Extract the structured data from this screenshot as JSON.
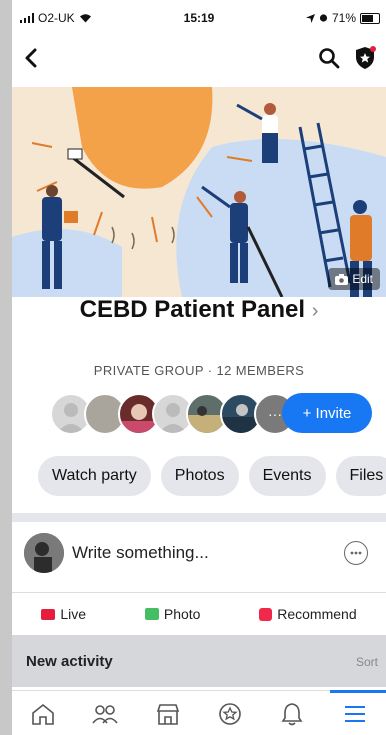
{
  "status_bar": {
    "carrier": "O2-UK",
    "time": "15:19",
    "battery": "71%"
  },
  "icons": {
    "back": "chevron-left-icon",
    "search": "search-icon",
    "shield": "shield-star-icon",
    "camera": "camera-icon",
    "more": "more-options-icon"
  },
  "cover": {
    "edit_label": "Edit"
  },
  "group": {
    "name": "CEBD Patient Panel",
    "chevron": "›",
    "meta": "PRIVATE GROUP · 12 MEMBERS"
  },
  "members": {
    "more_label": "···",
    "invite_label": "+ Invite"
  },
  "chips": [
    "Watch party",
    "Photos",
    "Events",
    "Files"
  ],
  "composer": {
    "placeholder": "Write something..."
  },
  "actions": {
    "live": "Live",
    "photo": "Photo",
    "recommend": "Recommend"
  },
  "activity": {
    "label": "New activity",
    "sort": "Sort"
  },
  "colors": {
    "accent": "#1877f2",
    "live": "#e41e3f",
    "photo": "#45bd62",
    "chip_bg": "#e4e6eb"
  }
}
